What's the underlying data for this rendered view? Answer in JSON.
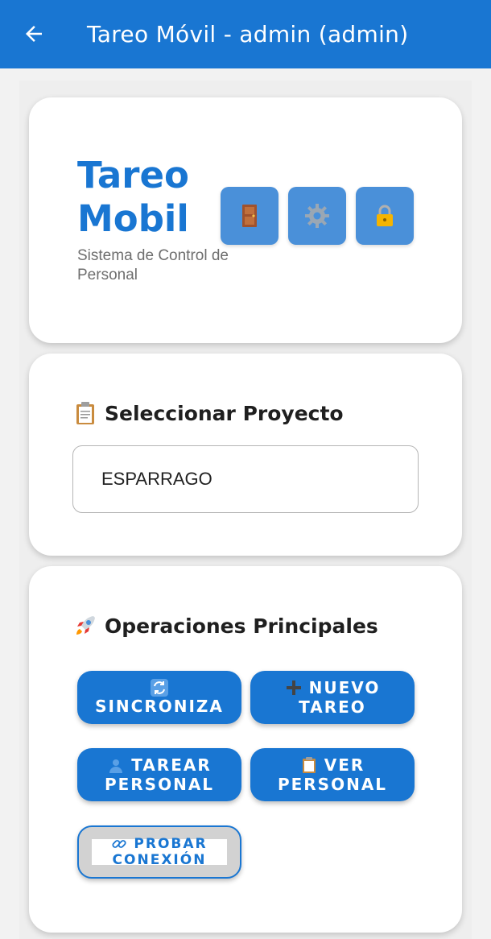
{
  "appbar": {
    "title": "Tareo Móvil - admin (admin)",
    "back_icon": "arrow-left-icon",
    "color": "#1976d2"
  },
  "header_card": {
    "title_line1": "Tareo",
    "title_line2": "Mobil",
    "subtitle": "Sistema de Control de Personal",
    "buttons": [
      {
        "icon": "door-icon"
      },
      {
        "icon": "gear-icon"
      },
      {
        "icon": "lock-icon"
      }
    ]
  },
  "project_card": {
    "title": "Seleccionar Proyecto",
    "icon": "clipboard-icon",
    "selected": "ESPARRAGO"
  },
  "ops_card": {
    "title": "Operaciones Principales",
    "icon": "rocket-icon",
    "buttons": [
      {
        "line1": "SINCRONIZA",
        "icon": "sync-icon"
      },
      {
        "line1": "NUEVO",
        "line2": "TAREO",
        "icon": "plus-icon"
      },
      {
        "line1": "TAREAR",
        "line2": "PERSONAL",
        "icon": "person-icon"
      },
      {
        "line1": "VER",
        "line2": "PERSONAL",
        "icon": "clipboard-icon"
      },
      {
        "line1": "PROBAR",
        "line2": "CONEXIÓN",
        "icon": "link-icon"
      }
    ]
  }
}
